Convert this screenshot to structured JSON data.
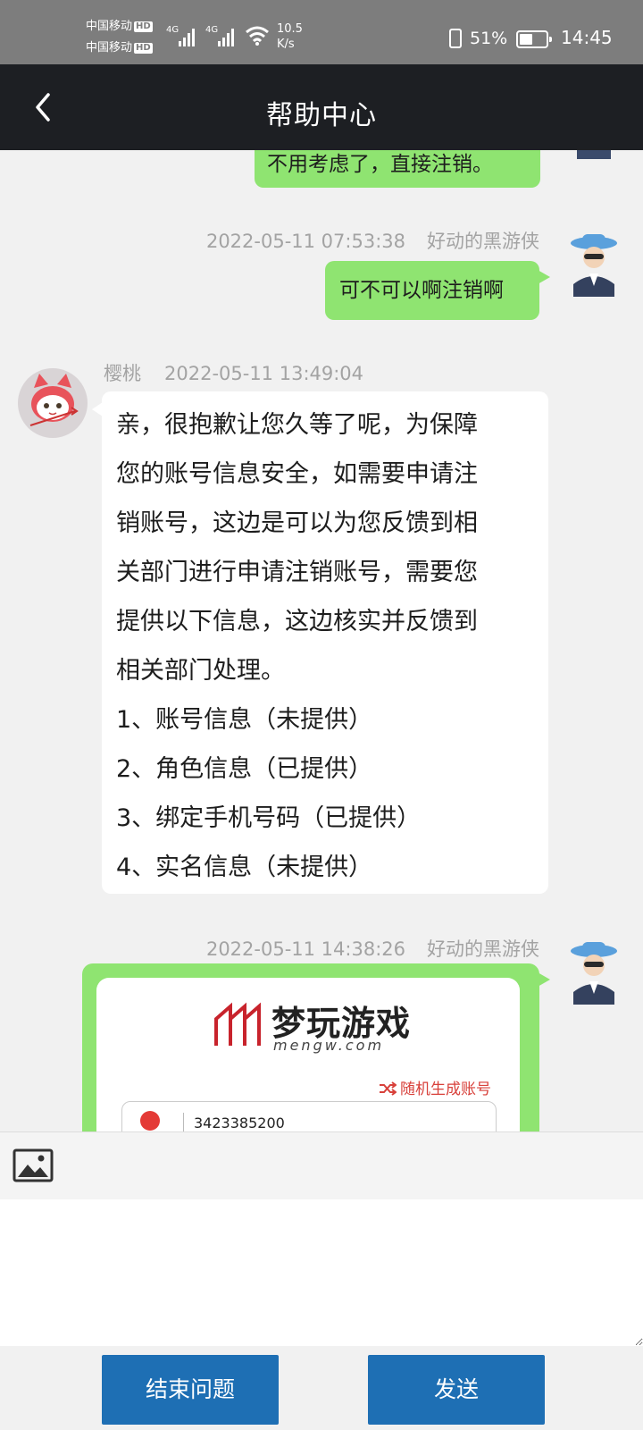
{
  "status_bar": {
    "carrier1": "中国移动",
    "carrier2": "中国移动",
    "hd_badge": "HD",
    "network": "4G",
    "speed_value": "10.5",
    "speed_unit": "K/s",
    "battery_pct": "51%",
    "battery_level": 0.51,
    "time": "14:45"
  },
  "header": {
    "title": "帮助中心"
  },
  "messages": [
    {
      "side": "right",
      "text": "不用考虑了，直接注销。"
    },
    {
      "side": "right",
      "time": "2022-05-11 07:53:38",
      "sender": "好动的黑游侠",
      "text": "可不可以啊注销啊"
    },
    {
      "side": "left",
      "sender": "樱桃",
      "time": "2022-05-11 13:49:04",
      "lines": [
        "亲，很抱歉让您久等了呢，为保障",
        "您的账号信息安全，如需要申请注",
        "销账号，这边是可以为您反馈到相",
        "关部门进行申请注销账号，需要您",
        "提供以下信息，这边核实并反馈到",
        "相关部门处理。",
        "1、账号信息（未提供）",
        "2、角色信息（已提供）",
        "3、绑定手机号码（已提供）",
        "4、实名信息（未提供）"
      ]
    },
    {
      "side": "right",
      "time": "2022-05-11 14:38:26",
      "sender": "好动的黑游侠",
      "image": {
        "brand": "梦玩游戏",
        "domain": "mengw.com",
        "random_label": "随机生成账号",
        "account_partial": "3423385200"
      }
    }
  ],
  "composer": {
    "placeholder": ""
  },
  "buttons": {
    "end": "结束问题",
    "send": "发送"
  },
  "colors": {
    "header_bg": "#1d1f23",
    "bubble_green": "#8fe471",
    "button_blue": "#1e6fb4",
    "status_bg": "#7d7d7d"
  },
  "icons": {
    "back": "chevron-left-icon",
    "image": "image-icon",
    "shuffle": "shuffle-icon"
  }
}
